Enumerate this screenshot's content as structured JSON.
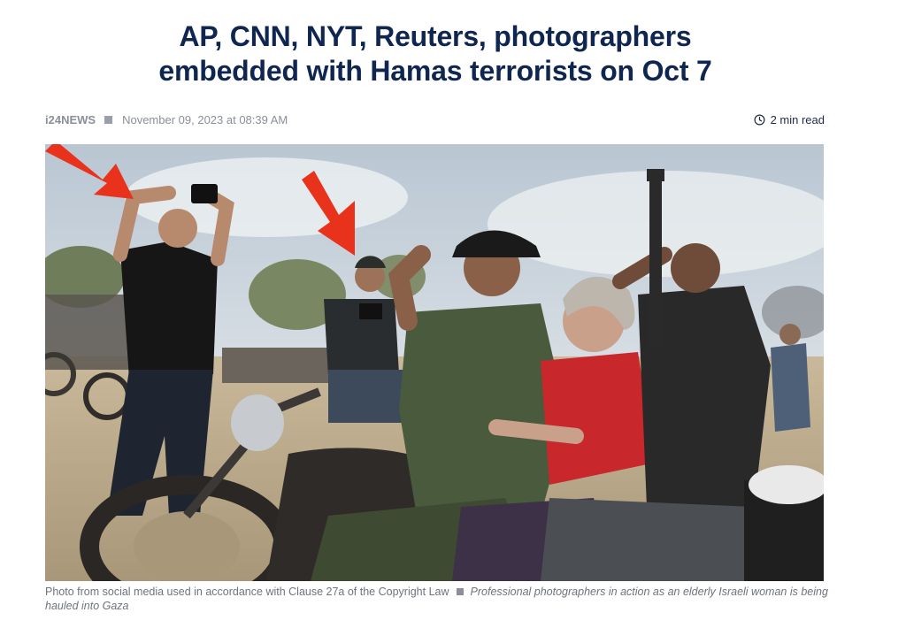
{
  "article": {
    "title_line1": "AP, CNN, NYT, Reuters, photographers",
    "title_line2": "embedded with Hamas terrorists on Oct 7",
    "source": "i24NEWS",
    "date": "November 09, 2023 at 08:39 AM",
    "read_time": "2 min read",
    "icons": {
      "read_time": "clock-icon"
    }
  },
  "photo": {
    "credit": "Photo from social media used in accordance with Clause 27a of the Copyright Law",
    "description": "Professional photographers in action as an elderly Israeli woman is being hauled into Gaza"
  },
  "colors": {
    "headline": "#0f2650",
    "meta_text": "#8a8f99",
    "arrow_red": "#e8321c"
  }
}
